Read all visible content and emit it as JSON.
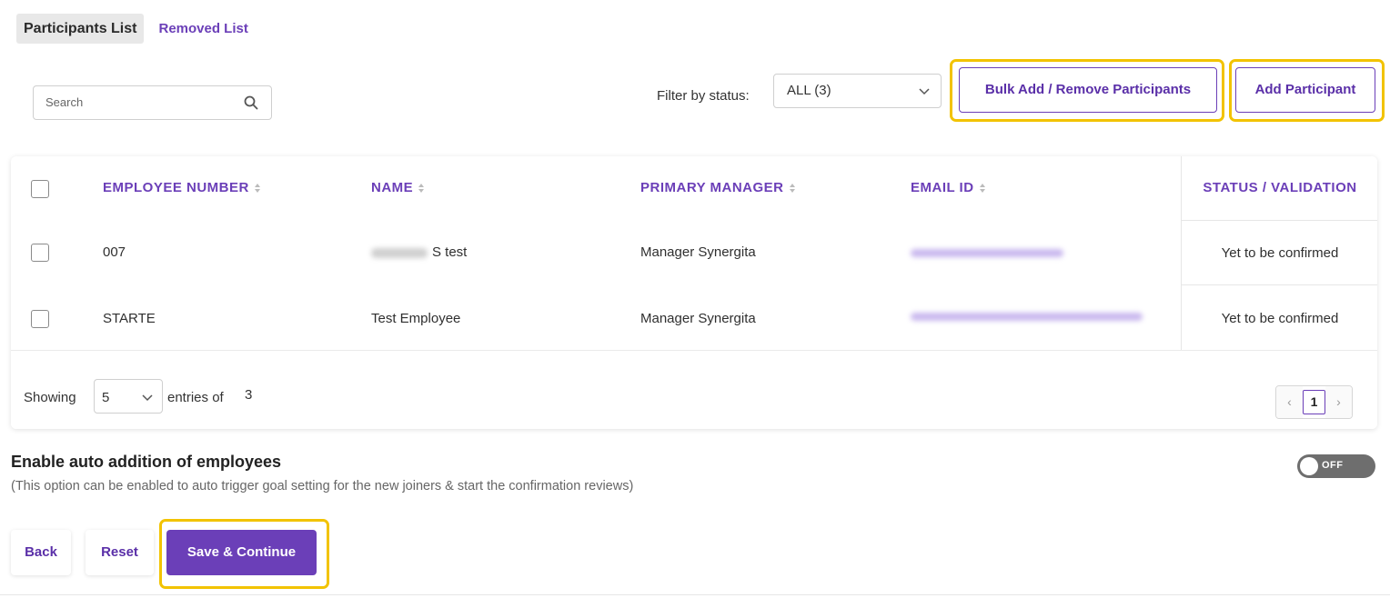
{
  "tabs": [
    {
      "label": "Participants List",
      "active": true
    },
    {
      "label": "Removed List",
      "active": false
    }
  ],
  "search": {
    "placeholder": "Search",
    "value": "",
    "icon": "search-icon"
  },
  "filter": {
    "label": "Filter by status:",
    "selected": "ALL (3)",
    "icon": "chevron-down-icon"
  },
  "actions": {
    "bulk_label": "Bulk Add / Remove Participants",
    "add_label": "Add Participant"
  },
  "table": {
    "columns": [
      {
        "label": "EMPLOYEE NUMBER",
        "sortable": true
      },
      {
        "label": "NAME",
        "sortable": true
      },
      {
        "label": "PRIMARY MANAGER",
        "sortable": true
      },
      {
        "label": "EMAIL ID",
        "sortable": true
      },
      {
        "label": "STATUS / VALIDATION",
        "sortable": false
      }
    ],
    "rows": [
      {
        "employee_number": "007",
        "name": "S test",
        "primary_manager": "Manager Synergita",
        "email": "",
        "status": "Yet to be confirmed"
      },
      {
        "employee_number": "STARTE",
        "name": "Test Employee",
        "primary_manager": "Manager Synergita",
        "email": "",
        "status": "Yet to be confirmed"
      }
    ]
  },
  "pagination": {
    "showing_label": "Showing",
    "page_size": "5",
    "entries_of_label": "entries of",
    "total": "3",
    "prev": "‹",
    "current_page": "1",
    "next": "›"
  },
  "auto_addition": {
    "title": "Enable auto addition of employees",
    "description": "(This option can be enabled to auto trigger goal setting for the new joiners & start the confirmation reviews)",
    "toggle_label": "OFF"
  },
  "footer": {
    "back_label": "Back",
    "reset_label": "Reset",
    "save_label": "Save & Continue"
  },
  "colors": {
    "accent": "#6b3fb8",
    "highlight": "#f2c300",
    "toggle_off": "#6e6e6e"
  }
}
